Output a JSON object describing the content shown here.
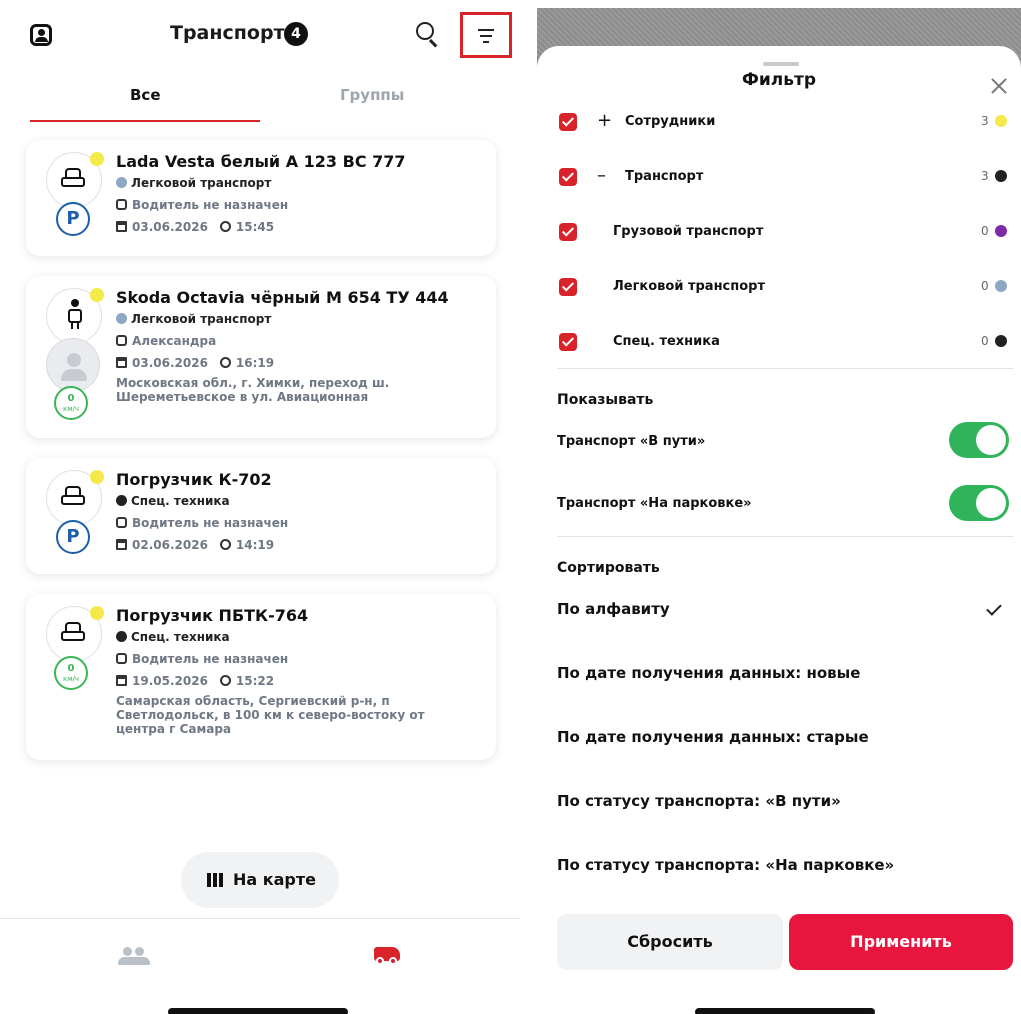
{
  "colors": {
    "accent": "#d8232a",
    "apply": "#e8163f",
    "toggle_on": "#2fb45a",
    "status_online": "#f5e94a",
    "parking": "#1c5fa8",
    "speed": "#3bb55a"
  },
  "list_screen": {
    "header": {
      "title": "Транспорт",
      "count": "4",
      "profile_icon": "profile-icon",
      "search_icon": "search-icon",
      "filter_icon": "filter-icon"
    },
    "tabs": [
      {
        "label": "Все",
        "active": true
      },
      {
        "label": "Группы",
        "active": false
      }
    ],
    "vehicles": [
      {
        "name": "Lada Vesta белый А 123 ВС 777",
        "type": "Легковой транспорт",
        "type_color": "#8da8c4",
        "driver": "Водитель не назначен",
        "date": "03.06.2026",
        "time": "15:45",
        "status": "parking",
        "status_label": "P",
        "address": ""
      },
      {
        "name": "Skoda Octavia чёрный М 654 ТУ 444",
        "type": "Легковой транспорт",
        "type_color": "#8da8c4",
        "driver": "Александра",
        "date": "03.06.2026",
        "time": "16:19",
        "status": "moving",
        "speed_value": "0",
        "speed_unit": "км/ч",
        "address": "Московская обл., г. Химки, переход ш. Шереметьевское в ул. Авиационная"
      },
      {
        "name": "Погрузчик К-702",
        "type": "Спец. техника",
        "type_color": "#222222",
        "driver": "Водитель не назначен",
        "date": "02.06.2026",
        "time": "14:19",
        "status": "parking",
        "status_label": "P",
        "address": ""
      },
      {
        "name": "Погрузчик ПБТК-764",
        "type": "Спец. техника",
        "type_color": "#222222",
        "driver": "Водитель не назначен",
        "date": "19.05.2026",
        "time": "15:22",
        "status": "moving",
        "speed_value": "0",
        "speed_unit": "км/ч",
        "address": "Самарская область, Сергиевский р-н, п Светлодольск, в 100 км к северо-востоку от центра г Самара"
      }
    ],
    "map_button": {
      "label": "На карте",
      "icon": "map-icon"
    },
    "bottom_nav": {
      "people_icon": "people-icon",
      "truck_icon": "truck-icon"
    }
  },
  "filter_sheet": {
    "title": "Фильтр",
    "close_icon": "close-icon",
    "categories": [
      {
        "label": "Сотрудники",
        "expand": "+",
        "count": "3",
        "color": "#f5e94a",
        "checked": true
      },
      {
        "label": "Транспорт",
        "expand": "–",
        "count": "3",
        "color": "#222222",
        "checked": true
      },
      {
        "label": "Грузовой транспорт",
        "expand": "",
        "count": "0",
        "color": "#7b2aa8",
        "checked": true
      },
      {
        "label": "Легковой транспорт",
        "expand": "",
        "count": "0",
        "color": "#8da8c4",
        "checked": true
      },
      {
        "label": "Спец. техника",
        "expand": "",
        "count": "0",
        "color": "#222222",
        "checked": true
      }
    ],
    "show_section": "Показывать",
    "show_toggles": [
      {
        "label": "Транспорт «В пути»",
        "on": true
      },
      {
        "label": "Транспорт «На парковке»",
        "on": true
      }
    ],
    "sort_section": "Сортировать",
    "sort_options": [
      {
        "label": "По алфавиту",
        "selected": true
      },
      {
        "label": "По дате получения данных: новые",
        "selected": false
      },
      {
        "label": "По дате получения данных: старые",
        "selected": false
      },
      {
        "label": "По статусу транспорта: «В пути»",
        "selected": false
      },
      {
        "label": "По статусу транспорта: «На парковке»",
        "selected": false
      }
    ],
    "reset_label": "Сбросить",
    "apply_label": "Применить"
  }
}
